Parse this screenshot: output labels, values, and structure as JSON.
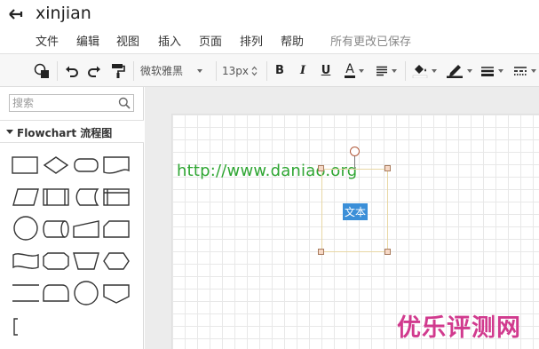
{
  "app": {
    "title": "xinjian",
    "save_status": "所有更改已保存"
  },
  "menu": {
    "items": [
      "文件",
      "编辑",
      "视图",
      "插入",
      "页面",
      "排列",
      "帮助"
    ]
  },
  "toolbar": {
    "font_family": "微软雅黑",
    "font_size": "13px",
    "bold_label": "B",
    "italic_label": "I",
    "underline_label": "U",
    "font_color_label": "A",
    "icons": [
      "style-icon",
      "undo-icon",
      "redo-icon",
      "format-painter-icon",
      "align-icon",
      "fill-color-icon",
      "line-color-icon",
      "line-weight-icon",
      "line-style-icon"
    ]
  },
  "sidebar": {
    "search": {
      "placeholder": "搜索",
      "value": ""
    },
    "library": {
      "title": "Flowchart 流程图"
    },
    "shapes": [
      "process",
      "decision",
      "terminator",
      "document",
      "data",
      "predefined-process",
      "stored-data",
      "internal-storage",
      "connector",
      "direct-access-storage",
      "manual-input",
      "card",
      "punched-tape",
      "preparation",
      "manual-operation",
      "display",
      "parallel-mode",
      "delay",
      "start",
      "off-page-connector",
      "annotation"
    ]
  },
  "canvas": {
    "url_text": "http://www.daniao.org",
    "shape_text": "文本"
  },
  "watermark": {
    "text": "优乐评测网"
  },
  "colors": {
    "url_green": "#2fa633",
    "selection": "#3b8fd8",
    "watermark": "#d13a8e"
  }
}
